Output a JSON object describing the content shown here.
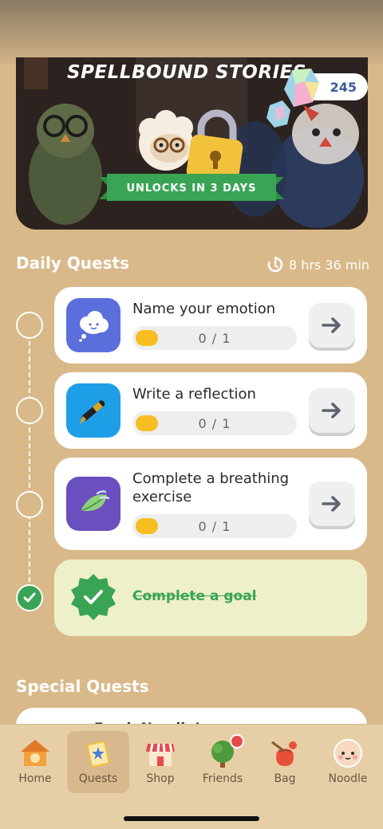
{
  "banner": {
    "title": "SPELLBOUND STORIES",
    "unlock_label": "UNLOCKS IN 3 DAYS",
    "gems_count": "245"
  },
  "daily_quests": {
    "title": "Daily Quests",
    "timer": "8 hrs 36 min",
    "items": [
      {
        "title": "Name your emotion",
        "progress": "0 / 1",
        "progress_fraction": 0,
        "icon": "thought-bubble-icon",
        "icon_color": "#5b6fdc"
      },
      {
        "title": "Write a reflection",
        "progress": "0 / 1",
        "progress_fraction": 0,
        "icon": "pen-icon",
        "icon_color": "#1f9ee8"
      },
      {
        "title_line1": "Complete a breathing",
        "title_line2": "exercise",
        "progress": "0 / 1",
        "progress_fraction": 0,
        "icon": "leaf-icon",
        "icon_color": "#6a4fbf"
      }
    ],
    "completed_goal": {
      "title": "Complete a goal",
      "status": "done",
      "accent": "#3aa455"
    }
  },
  "special_quests": {
    "title": "Special Quests",
    "peek_text": "Fresh Noodle!"
  },
  "nav": {
    "items": [
      {
        "label": "Home",
        "icon": "house-icon"
      },
      {
        "label": "Quests",
        "icon": "quest-book-icon",
        "active": true
      },
      {
        "label": "Shop",
        "icon": "shop-icon"
      },
      {
        "label": "Friends",
        "icon": "tree-icon",
        "badge": true
      },
      {
        "label": "Bag",
        "icon": "bag-icon"
      },
      {
        "label": "Noodle",
        "icon": "noodle-face-icon"
      }
    ]
  }
}
